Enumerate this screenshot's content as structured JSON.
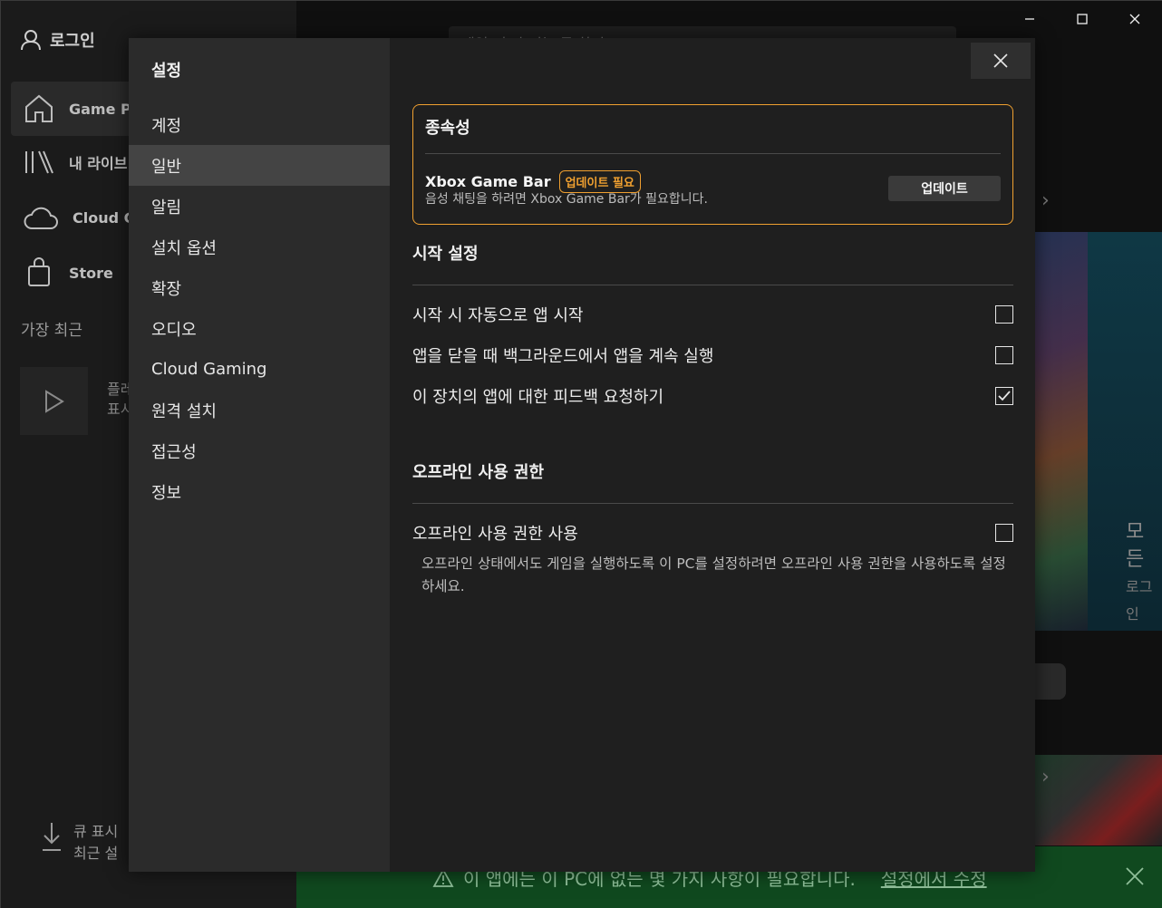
{
  "window": {
    "minimize": "minimize",
    "maximize": "maximize",
    "close": "close"
  },
  "background": {
    "login_label": "로그인",
    "nav": [
      {
        "label": "Game Pa"
      },
      {
        "label": "내 라이브"
      },
      {
        "label": "Cloud Ga"
      },
      {
        "label": "Store"
      }
    ],
    "recent_label": "가장 최근",
    "tile_text_1": "플레",
    "tile_text_2": "표시",
    "queue_1": "큐 표시",
    "queue_2": "최근 설",
    "search_placeholder": "게임, 추가 기능 등 찾기",
    "right_text": "모든",
    "right_sub": "로그인",
    "warning_text": "이 앱에는 이 PC에 없는 몇 가지 사항이 필요합니다.",
    "warning_link": "설정에서 수정"
  },
  "settings": {
    "title": "설정",
    "nav": [
      {
        "label": "계정",
        "active": false
      },
      {
        "label": "일반",
        "active": true
      },
      {
        "label": "알림",
        "active": false
      },
      {
        "label": "설치 옵션",
        "active": false
      },
      {
        "label": "확장",
        "active": false
      },
      {
        "label": "오디오",
        "active": false
      },
      {
        "label": "Cloud Gaming",
        "active": false
      },
      {
        "label": "원격 설치",
        "active": false
      },
      {
        "label": "접근성",
        "active": false
      },
      {
        "label": "정보",
        "active": false
      }
    ],
    "dependency": {
      "title": "종속성",
      "name": "Xbox Game Bar",
      "badge": "업데이트 필요",
      "description": "음성 채팅을 하려면 Xbox Game Bar가 필요합니다.",
      "button": "업데이트"
    },
    "startup": {
      "title": "시작 설정",
      "options": [
        {
          "label": "시작 시 자동으로 앱 시작",
          "checked": false
        },
        {
          "label": "앱을 닫을 때 백그라운드에서 앱을 계속 실행",
          "checked": false
        },
        {
          "label": "이 장치의 앱에 대한 피드백 요청하기",
          "checked": true
        }
      ]
    },
    "offline": {
      "title": "오프라인 사용 권한",
      "option_label": "오프라인 사용 권한 사용",
      "option_checked": false,
      "note": "오프라인 상태에서도 게임을 실행하도록 이 PC를 설정하려면 오프라인 사용 권한을 사용하도록 설정하세요."
    }
  },
  "colors": {
    "accent": "#f0a030",
    "warning_bg": "#10491f"
  }
}
